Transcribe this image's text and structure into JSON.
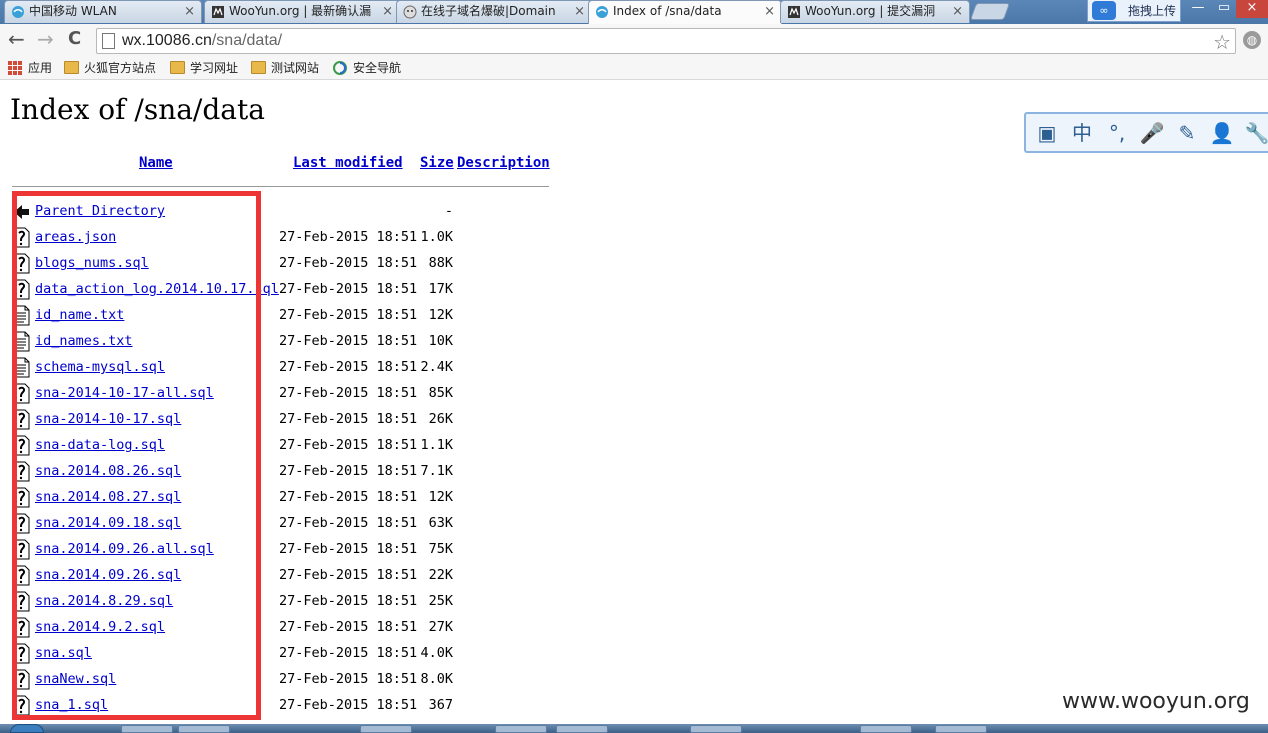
{
  "browser": {
    "tabs": [
      {
        "title": "中国移动 WLAN",
        "active": false
      },
      {
        "title": "WooYun.org | 最新确认漏",
        "active": false
      },
      {
        "title": "在线子域名爆破|Domain",
        "active": false
      },
      {
        "title": "Index of /sna/data",
        "active": true
      },
      {
        "title": "WooYun.org | 提交漏洞",
        "active": false
      }
    ],
    "tab_close": "×",
    "cloud_upload_label": "拖拽上传",
    "cloud_icon_text": "∞",
    "window_controls": {
      "minimize": "—",
      "maximize": "▭",
      "close": "×"
    },
    "nav": {
      "back": "←",
      "forward": "→",
      "reload": "C"
    },
    "url_host": "wx.10086.cn",
    "url_path": "/sna/data/",
    "star": "☆",
    "globe_icon": "globe-icon",
    "bookmarks": [
      {
        "label": "应用",
        "icon": "apps-grid-icon"
      },
      {
        "label": "火狐官方站点",
        "icon": "folder-icon"
      },
      {
        "label": "学习网址",
        "icon": "folder-icon"
      },
      {
        "label": "测试网站",
        "icon": "folder-icon"
      },
      {
        "label": "安全导航",
        "icon": "swirl-icon"
      }
    ]
  },
  "listing": {
    "title": "Index of /sna/data",
    "columns": {
      "name": "Name",
      "last_modified": "Last modified",
      "size": "Size",
      "description": "Description"
    },
    "parent": {
      "name": "Parent Directory",
      "date": "",
      "size": "-"
    },
    "files": [
      {
        "name": "areas.json",
        "date": "27-Feb-2015 18:51",
        "size": "1.0K",
        "kind": "unknown"
      },
      {
        "name": "blogs_nums.sql",
        "date": "27-Feb-2015 18:51",
        "size": "88K",
        "kind": "unknown"
      },
      {
        "name": "data_action_log.2014.10.17.sql",
        "date": "27-Feb-2015 18:51",
        "size": "17K",
        "kind": "unknown"
      },
      {
        "name": "id_name.txt",
        "date": "27-Feb-2015 18:51",
        "size": "12K",
        "kind": "text"
      },
      {
        "name": "id_names.txt",
        "date": "27-Feb-2015 18:51",
        "size": "10K",
        "kind": "text"
      },
      {
        "name": "schema-mysql.sql",
        "date": "27-Feb-2015 18:51",
        "size": "2.4K",
        "kind": "text"
      },
      {
        "name": "sna-2014-10-17-all.sql",
        "date": "27-Feb-2015 18:51",
        "size": "85K",
        "kind": "unknown"
      },
      {
        "name": "sna-2014-10-17.sql",
        "date": "27-Feb-2015 18:51",
        "size": "26K",
        "kind": "unknown"
      },
      {
        "name": "sna-data-log.sql",
        "date": "27-Feb-2015 18:51",
        "size": "1.1K",
        "kind": "unknown"
      },
      {
        "name": "sna.2014.08.26.sql",
        "date": "27-Feb-2015 18:51",
        "size": "7.1K",
        "kind": "unknown"
      },
      {
        "name": "sna.2014.08.27.sql",
        "date": "27-Feb-2015 18:51",
        "size": "12K",
        "kind": "unknown"
      },
      {
        "name": "sna.2014.09.18.sql",
        "date": "27-Feb-2015 18:51",
        "size": "63K",
        "kind": "unknown"
      },
      {
        "name": "sna.2014.09.26.all.sql",
        "date": "27-Feb-2015 18:51",
        "size": "75K",
        "kind": "unknown"
      },
      {
        "name": "sna.2014.09.26.sql",
        "date": "27-Feb-2015 18:51",
        "size": "22K",
        "kind": "unknown"
      },
      {
        "name": "sna.2014.8.29.sql",
        "date": "27-Feb-2015 18:51",
        "size": "25K",
        "kind": "unknown"
      },
      {
        "name": "sna.2014.9.2.sql",
        "date": "27-Feb-2015 18:51",
        "size": "27K",
        "kind": "unknown"
      },
      {
        "name": "sna.sql",
        "date": "27-Feb-2015 18:51",
        "size": "4.0K",
        "kind": "unknown"
      },
      {
        "name": "snaNew.sql",
        "date": "27-Feb-2015 18:51",
        "size": "8.0K",
        "kind": "unknown"
      },
      {
        "name": "sna_1.sql",
        "date": "27-Feb-2015 18:51",
        "size": "367",
        "kind": "unknown"
      }
    ]
  },
  "ime_toolbar": {
    "items": [
      {
        "icon": "ime-panel-icon",
        "glyph": "▣"
      },
      {
        "icon": "chinese-mode-icon",
        "glyph": "中"
      },
      {
        "icon": "punctuation-icon",
        "glyph": "°,"
      },
      {
        "icon": "microphone-icon",
        "glyph": "🎤"
      },
      {
        "icon": "handwriting-icon",
        "glyph": "✎"
      },
      {
        "icon": "user-icon",
        "glyph": "👤"
      },
      {
        "icon": "tools-icon",
        "glyph": "🔧"
      }
    ]
  },
  "highlight_color": "#ee3535",
  "watermark": "www.wooyun.org"
}
